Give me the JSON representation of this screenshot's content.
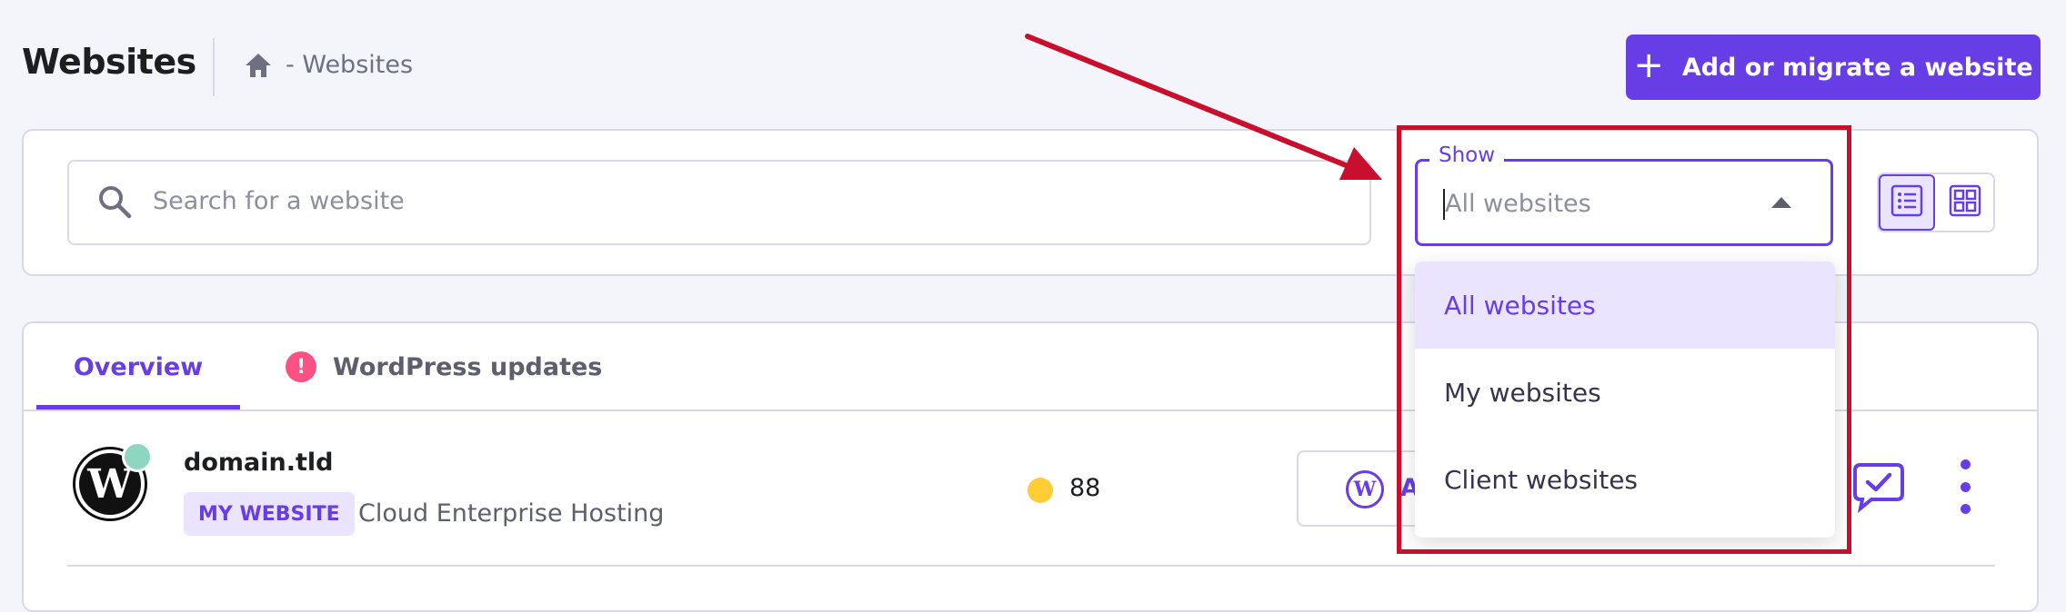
{
  "header": {
    "title": "Websites",
    "breadcrumb": "- Websites",
    "add_button_icon": "+",
    "add_button_label": "Add or migrate a website"
  },
  "filters": {
    "search_placeholder": "Search for a website",
    "show_label": "Show",
    "show_selected": "All websites",
    "show_options": [
      "All websites",
      "My websites",
      "Client websites"
    ]
  },
  "tabs": [
    {
      "label": "Overview",
      "active": true
    },
    {
      "label": "WordPress updates",
      "alert": "!"
    }
  ],
  "website": {
    "logo_letter": "W",
    "domain": "domain.tld",
    "badge": "MY WEBSITE",
    "plan": "Cloud Enterprise Hosting",
    "score": "88",
    "action_letter": "W",
    "action_label_partial": "A"
  },
  "colors": {
    "brand": "#673de6",
    "alert": "#fc5185",
    "score": "#ffcd35",
    "status": "#8ed6c0",
    "annotation": "#c8102e"
  }
}
